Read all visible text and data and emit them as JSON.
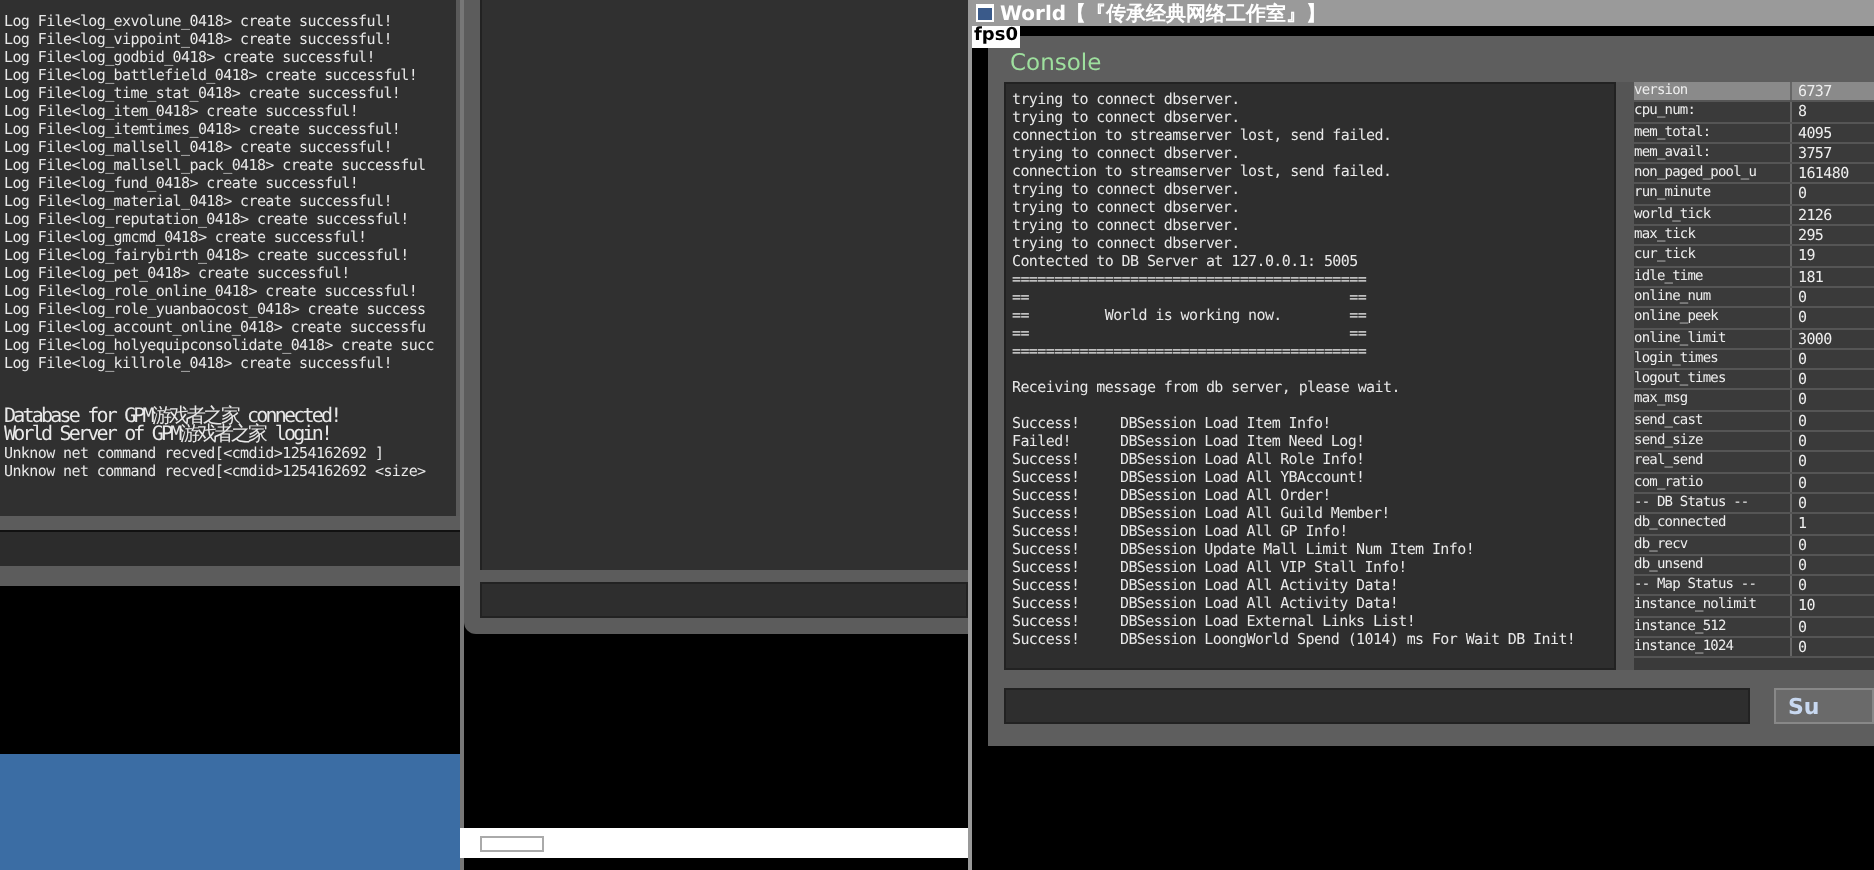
{
  "left_console": {
    "log_lines": [
      "Log File<log_exvolune_0418> create successful!",
      "Log File<log_vippoint_0418> create successful!",
      "Log File<log_godbid_0418> create successful!",
      "Log File<log_battlefield_0418> create successful!",
      "Log File<log_time_stat_0418> create successful!",
      "Log File<log_item_0418> create successful!",
      "Log File<log_itemtimes_0418> create successful!",
      "Log File<log_mallsell_0418> create successful!",
      "Log File<log_mallsell_pack_0418> create successful",
      "Log File<log_fund_0418> create successful!",
      "Log File<log_material_0418> create successful!",
      "Log File<log_reputation_0418> create successful!",
      "Log File<log_gmcmd_0418> create successful!",
      "Log File<log_fairybirth_0418> create successful!",
      "Log File<log_pet_0418> create successful!",
      "Log File<log_role_online_0418> create successful!",
      "Log File<log_role_yuanbaocost_0418> create success",
      "Log File<log_account_online_0418> create successfu",
      "Log File<log_holyequipconsolidate_0418> create succ",
      "Log File<log_killrole_0418> create successful!"
    ],
    "login_messages": [
      "Database for GPM游戏者之家 connected!",
      "World Server of GPM游戏者之家 login!"
    ],
    "unknown_commands": [
      "Unknow net command recved[<cmdid>1254162692 ]",
      "Unknow net command recved[<cmdid>1254162692 <size>"
    ]
  },
  "world_window": {
    "title": "World【『传承经典网络工作室』】",
    "fps": "fps0",
    "heading": "Console",
    "log_lines": [
      "trying to connect dbserver.",
      "trying to connect dbserver.",
      "connection to streamserver lost, send failed.",
      "trying to connect dbserver.",
      "connection to streamserver lost, send failed.",
      "trying to connect dbserver.",
      "trying to connect dbserver.",
      "trying to connect dbserver.",
      "trying to connect dbserver.",
      "Contected to DB Server at 127.0.0.1: 5005",
      "==========================================",
      "==                                      ==",
      "==         World is working now.        ==",
      "==                                      ==",
      "=========================================="
    ],
    "receiving": "Receiving message from db server, please wait.",
    "load_results": [
      {
        "status": "Success!",
        "message": "DBSession Load Item Info!"
      },
      {
        "status": "Failed!",
        "message": "DBSession Load Item Need Log!"
      },
      {
        "status": "Success!",
        "message": "DBSession Load All Role Info!"
      },
      {
        "status": "Success!",
        "message": "DBSession Load All YBAccount!"
      },
      {
        "status": "Success!",
        "message": "DBSession Load All Order!"
      },
      {
        "status": "Success!",
        "message": "DBSession Load All Guild Member!"
      },
      {
        "status": "Success!",
        "message": "DBSession Load All GP Info!"
      },
      {
        "status": "Success!",
        "message": "DBSession Update Mall Limit Num Item Info!"
      },
      {
        "status": "Success!",
        "message": "DBSession Load All VIP Stall Info!"
      },
      {
        "status": "Success!",
        "message": "DBSession Load All Activity Data!"
      },
      {
        "status": "Success!",
        "message": "DBSession Load All Activity Data!"
      },
      {
        "status": "Success!",
        "message": "DBSession Load External Links List!"
      },
      {
        "status": "Success!",
        "message": "DBSession LoongWorld Spend (1014) ms For Wait DB Init!"
      }
    ],
    "stats": [
      {
        "name": "version",
        "value": "6737",
        "selected": true
      },
      {
        "name": "cpu_num:",
        "value": "8",
        "selected": false
      },
      {
        "name": "mem_total:",
        "value": "4095",
        "selected": false
      },
      {
        "name": "mem_avail:",
        "value": "3757",
        "selected": false
      },
      {
        "name": "non_paged_pool_u",
        "value": "161480",
        "selected": false
      },
      {
        "name": "run_minute",
        "value": "0",
        "selected": false
      },
      {
        "name": "world_tick",
        "value": "2126",
        "selected": false
      },
      {
        "name": "max_tick",
        "value": "295",
        "selected": false
      },
      {
        "name": "cur_tick",
        "value": "19",
        "selected": false
      },
      {
        "name": "idle_time",
        "value": "181",
        "selected": false
      },
      {
        "name": "online_num",
        "value": "0",
        "selected": false
      },
      {
        "name": "online_peek",
        "value": "0",
        "selected": false
      },
      {
        "name": "online_limit",
        "value": "3000",
        "selected": false
      },
      {
        "name": "login_times",
        "value": "0",
        "selected": false
      },
      {
        "name": "logout_times",
        "value": "0",
        "selected": false
      },
      {
        "name": "max_msg",
        "value": "0",
        "selected": false
      },
      {
        "name": "send_cast",
        "value": "0",
        "selected": false
      },
      {
        "name": "send_size",
        "value": "0",
        "selected": false
      },
      {
        "name": "real_send",
        "value": "0",
        "selected": false
      },
      {
        "name": "com_ratio",
        "value": "0",
        "selected": false
      },
      {
        "name": "-- DB Status --",
        "value": "0",
        "selected": false
      },
      {
        "name": "db_connected",
        "value": "1",
        "selected": false
      },
      {
        "name": "db_recv",
        "value": "0",
        "selected": false
      },
      {
        "name": "db_unsend",
        "value": "0",
        "selected": false
      },
      {
        "name": "-- Map Status --",
        "value": "0",
        "selected": false
      },
      {
        "name": "instance_nolimit",
        "value": "10",
        "selected": false
      },
      {
        "name": "instance_512",
        "value": "0",
        "selected": false
      },
      {
        "name": "instance_1024",
        "value": "0",
        "selected": false
      }
    ],
    "submit_button": "Su"
  }
}
